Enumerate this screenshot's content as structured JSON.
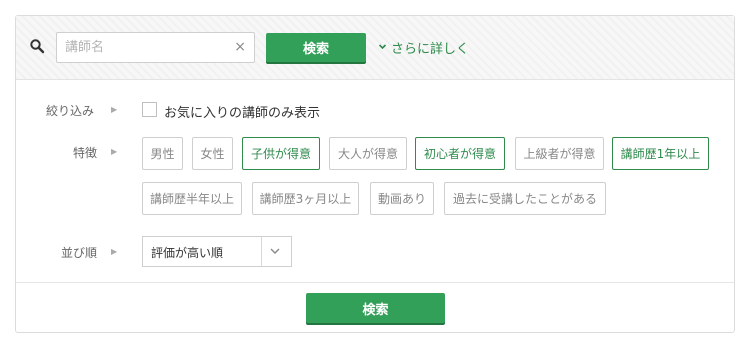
{
  "search": {
    "placeholder": "講師名",
    "clear_icon": "close-icon",
    "button_label": "検索",
    "more_label": "さらに詳しく"
  },
  "filters": {
    "narrow_label": "絞り込み",
    "favorites_label": "お気に入りの講師のみ表示",
    "favorites_checked": false,
    "features_label": "特徴",
    "tags": [
      {
        "label": "男性",
        "active": false
      },
      {
        "label": "女性",
        "active": false
      },
      {
        "label": "子供が得意",
        "active": true
      },
      {
        "label": "大人が得意",
        "active": false
      },
      {
        "label": "初心者が得意",
        "active": true
      },
      {
        "label": "上級者が得意",
        "active": false
      },
      {
        "label": "講師歴1年以上",
        "active": true
      },
      {
        "label": "講師歴半年以上",
        "active": false
      },
      {
        "label": "講師歴3ヶ月以上",
        "active": false
      },
      {
        "label": "動画あり",
        "active": false
      },
      {
        "label": "過去に受講したことがある",
        "active": false
      }
    ],
    "sort_label": "並び順",
    "sort_value": "評価が高い順"
  },
  "footer": {
    "search_label": "検索"
  },
  "colors": {
    "accent": "#33a05a",
    "accent_text": "#2f8a4c",
    "border": "#cfcfcf"
  }
}
